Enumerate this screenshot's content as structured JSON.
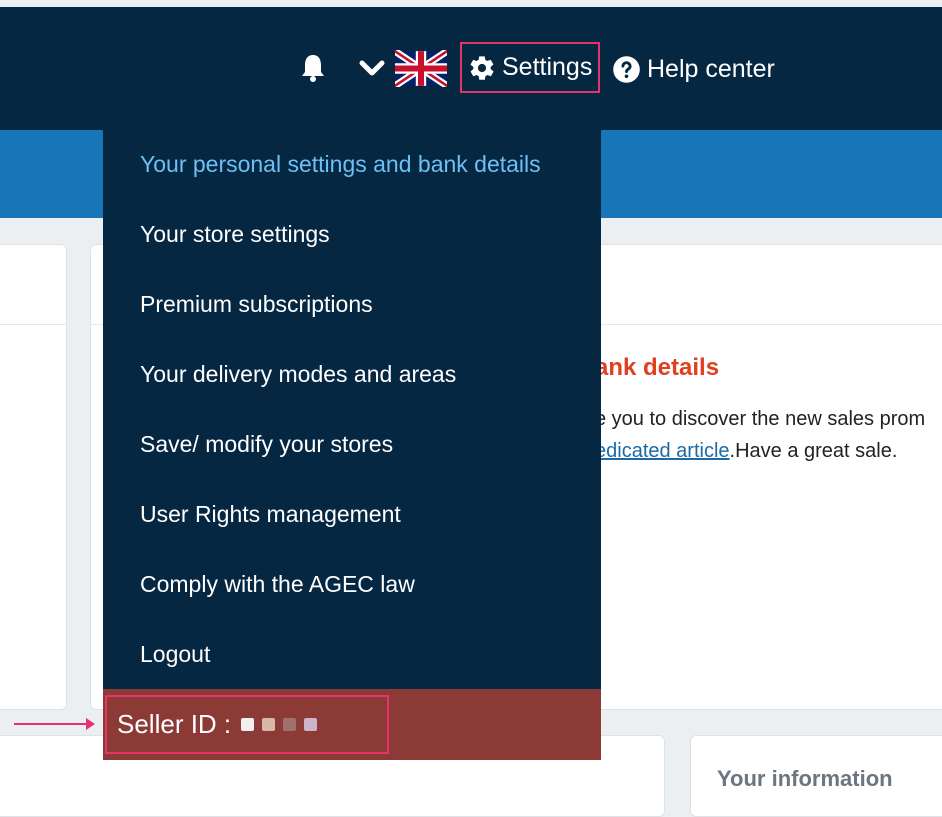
{
  "header": {
    "settings_label": "Settings",
    "help_label": "Help center",
    "icons": {
      "bell": "bell-icon",
      "chevron": "chevron-down-icon",
      "flag": "uk-flag-icon",
      "settings": "gear-icon",
      "help": "question-circle-icon"
    }
  },
  "alert": {
    "title_fragment": "ank details",
    "line1_fragment": "e you to discover the new sales prom",
    "link_fragment": "edicated article",
    "line2_tail": ".Have a great sale."
  },
  "dropdown": {
    "items": [
      {
        "label": "Your personal settings and bank details",
        "active": true
      },
      {
        "label": "Your store settings"
      },
      {
        "label": "Premium subscriptions"
      },
      {
        "label": "Your delivery modes and areas"
      },
      {
        "label": "Save/ modify your stores"
      },
      {
        "label": "User Rights management"
      },
      {
        "label": "Comply with the AGEC law"
      },
      {
        "label": "Logout"
      }
    ],
    "seller_id_label": "Seller ID :"
  },
  "cards": {
    "your_information_title": "Your information"
  },
  "colors": {
    "navy": "#062742",
    "blue_band": "#1676b8",
    "active_item": "#6cc0f5",
    "highlight_border": "#e5336c",
    "seller_bar": "#8b3a36",
    "alert_title": "#e0401f",
    "link": "#1a6aa8"
  }
}
